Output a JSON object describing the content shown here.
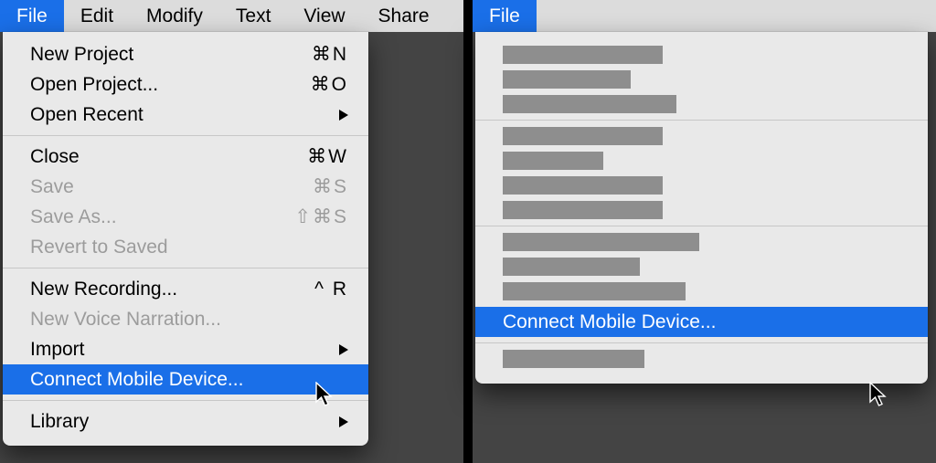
{
  "left": {
    "menubar": [
      "File",
      "Edit",
      "Modify",
      "Text",
      "View",
      "Share"
    ],
    "menubar_selected_index": 0,
    "groups": [
      [
        {
          "label": "New Project",
          "shortcut": "⌘N",
          "disabled": false,
          "submenu": false
        },
        {
          "label": "Open Project...",
          "shortcut": "⌘O",
          "disabled": false,
          "submenu": false
        },
        {
          "label": "Open Recent",
          "shortcut": "",
          "disabled": false,
          "submenu": true
        }
      ],
      [
        {
          "label": "Close",
          "shortcut": "⌘W",
          "disabled": false,
          "submenu": false
        },
        {
          "label": "Save",
          "shortcut": "⌘S",
          "disabled": true,
          "submenu": false
        },
        {
          "label": "Save As...",
          "shortcut": "⇧⌘S",
          "disabled": true,
          "submenu": false
        },
        {
          "label": "Revert to Saved",
          "shortcut": "",
          "disabled": true,
          "submenu": false
        }
      ],
      [
        {
          "label": "New Recording...",
          "shortcut": "^ R",
          "disabled": false,
          "submenu": false
        },
        {
          "label": "New Voice Narration...",
          "shortcut": "",
          "disabled": true,
          "submenu": false
        },
        {
          "label": "Import",
          "shortcut": "",
          "disabled": false,
          "submenu": true
        },
        {
          "label": "Connect Mobile Device...",
          "shortcut": "",
          "disabled": false,
          "submenu": false,
          "highlight": true
        }
      ],
      [
        {
          "label": "Library",
          "shortcut": "",
          "disabled": false,
          "submenu": true
        }
      ]
    ]
  },
  "right": {
    "menubar": [
      "File"
    ],
    "menubar_selected_index": 0,
    "skeleton_groups": [
      [
        175,
        140,
        190
      ],
      [
        175,
        110,
        175,
        175
      ],
      [
        215,
        150,
        200
      ],
      [
        155
      ]
    ],
    "highlight_label": "Connect Mobile Device..."
  }
}
